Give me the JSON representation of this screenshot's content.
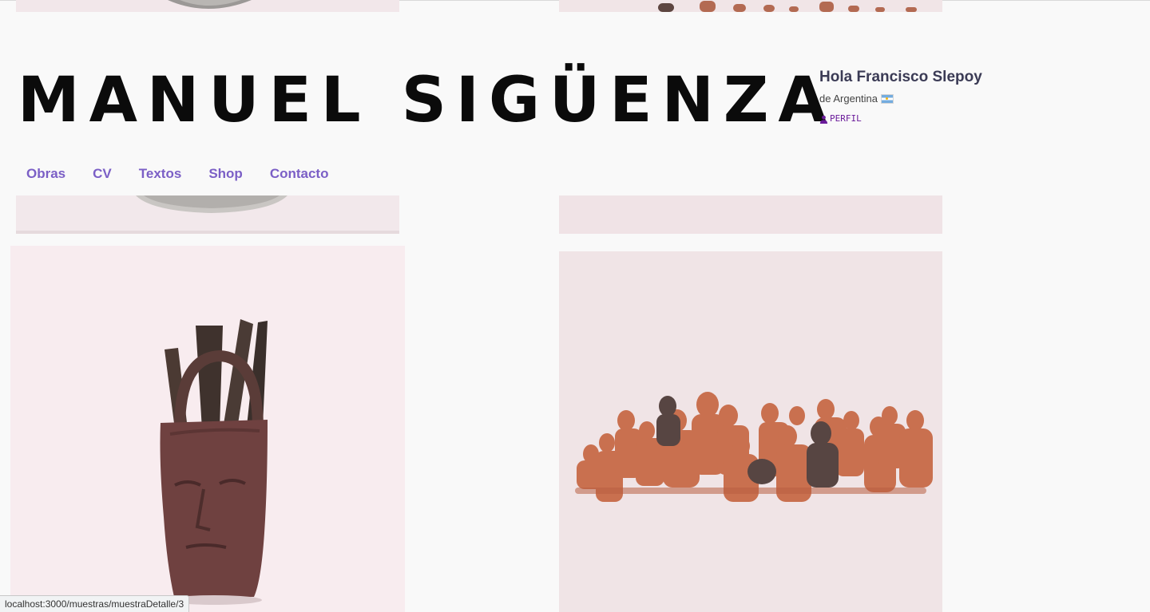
{
  "site": {
    "title": "MANUEL SIGÜENZA"
  },
  "user": {
    "greeting": "Hola Francisco Slepoy",
    "country": "de Argentina",
    "flag_icon": "argentina-flag-icon",
    "profile_label": "PERFIL",
    "profile_icon": "person-icon",
    "link_color": "#6a1b9a"
  },
  "nav": {
    "items": [
      {
        "label": "Obras"
      },
      {
        "label": "CV"
      },
      {
        "label": "Textos"
      },
      {
        "label": "Shop"
      },
      {
        "label": "Contacto"
      }
    ],
    "color": "#7b5fc6"
  },
  "gallery": {
    "tiles": [
      {
        "name": "artwork-top-left",
        "subject": "grey stone sculpture (partially visible)"
      },
      {
        "name": "artwork-top-right",
        "subject": "row of small clay figures (partially visible)"
      },
      {
        "name": "artwork-mid-left",
        "subject": "grey stone sculpture base (partially visible)"
      },
      {
        "name": "artwork-mid-right",
        "subject": "blank pink background (partially visible)"
      },
      {
        "name": "artwork-bottom-left",
        "subject": "dark clay head vessel holding sculpting tools"
      },
      {
        "name": "artwork-bottom-right",
        "subject": "group of terracotta figurines"
      }
    ]
  },
  "status_bar": {
    "url": "localhost:3000/muestras/muestraDetalle/3"
  }
}
